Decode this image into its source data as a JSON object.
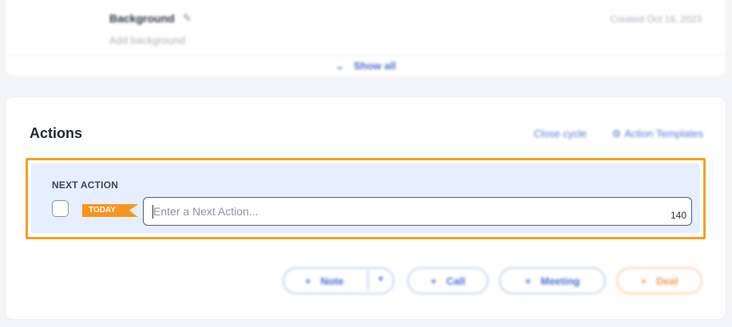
{
  "top_card": {
    "background_title": "Background",
    "created_text": "Created Oct 18, 2023",
    "add_background": "Add background",
    "show_all": "Show all"
  },
  "actions": {
    "title": "Actions",
    "close_cycle": "Close cycle",
    "action_templates": "Action Templates",
    "next_action_label": "NEXT ACTION",
    "today_tag": "TODAY",
    "input_placeholder": "Enter a Next Action...",
    "input_value": "",
    "char_count": "140"
  },
  "buttons": {
    "note": "Note",
    "call": "Call",
    "meeting": "Meeting",
    "deal": "Deal",
    "plus": "+"
  },
  "colors": {
    "highlight_border": "#f5a11c",
    "panel_bg": "#e6efff",
    "today_tag": "#f7941d",
    "accent_blue": "#4a6fd0"
  }
}
